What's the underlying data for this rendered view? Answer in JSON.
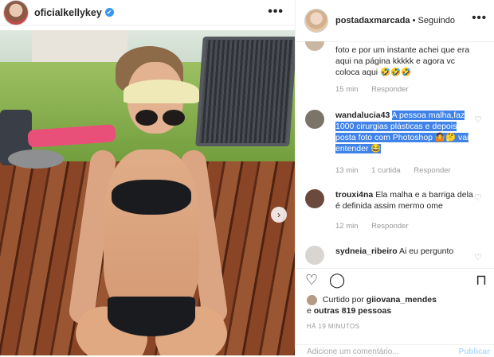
{
  "post": {
    "username": "oficialkellykey",
    "verified_icon": "✔"
  },
  "side": {
    "username": "postadaxmarcada",
    "follow_status": "• Seguindo"
  },
  "comments": [
    {
      "text": "foto e por um instante achei que era aqui na página kkkkk e agora vc coloca aqui 🤣🤣🤣",
      "time": "15 min",
      "reply": "Responder"
    },
    {
      "user": "wandalucia43",
      "text": "A pessoa malha,faz 1000 cirurgias plásticas e depois posta foto com Photoshop 🤷🤔 vai entender 😂",
      "time": "13 min",
      "likes": "1 curtida",
      "reply": "Responder"
    },
    {
      "user": "trouxi4na",
      "text": "Ela malha e a barriga dela é definida assim mermo ome",
      "time": "12 min",
      "reply": "Responder"
    },
    {
      "user": "sydneia_ribeiro",
      "text": "Ai eu pergunto"
    }
  ],
  "likes": {
    "prefix": "Curtido por",
    "user": "giiovana_mendes",
    "suffix_e": "e",
    "others": "outras 819 pessoas"
  },
  "timestamp": "HÁ 19 MINUTOS",
  "add_comment": {
    "placeholder": "Adicione um comentário...",
    "publish": "Publicar"
  }
}
